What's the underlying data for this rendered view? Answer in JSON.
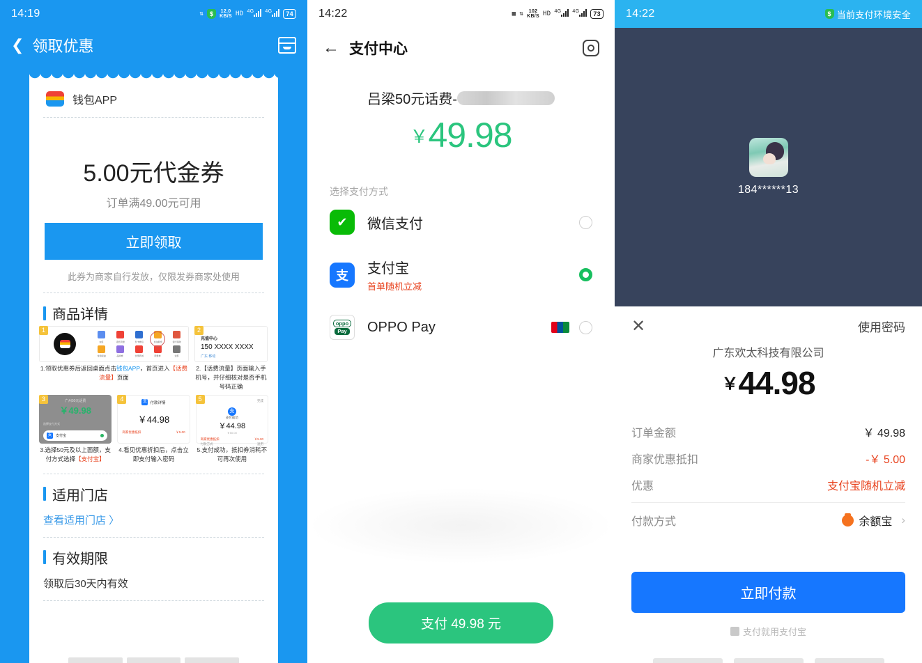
{
  "panel1": {
    "statusbar": {
      "time": "14:19",
      "net_speed": "12.0",
      "net_unit": "KB/S",
      "hd": "HD",
      "net_type": "4G",
      "battery": "74"
    },
    "header": {
      "title": "领取优惠",
      "back_icon": "back-chevron",
      "right_icon": "ticket-icon"
    },
    "app": {
      "name": "钱包APP"
    },
    "coupon": {
      "amount": "5.00元代金券",
      "condition": "订单满49.00元可用",
      "claim_button": "立即领取",
      "note": "此券为商家自行发放，仅限发券商家处使用"
    },
    "sections": {
      "product_detail_title": "商品详情",
      "stores_title": "适用门店",
      "stores_link": "查看适用门店 〉",
      "validity_title": "有效期限",
      "validity_text": "领取后30天内有效"
    },
    "steps": [
      {
        "num": "1",
        "caption_pre": "1.领取优惠券后返回桌面点击",
        "caption_hl": "钱包APP",
        "caption_mid": "，首页进入",
        "caption_hl2": "【话费流量】",
        "caption_post": "页面",
        "shot": {
          "grid_labels": [
            "充值",
            "话费流量",
            "影卡券包",
            "加油服务",
            "银行理财",
            "常用权益",
            "品牌券",
            "优惠商城",
            "限量券",
            "全部"
          ],
          "highlight": "话费流量"
        }
      },
      {
        "num": "2",
        "caption": "2.【话费流量】页面输入手机号，并仔细核对是否手机号码正确",
        "shot": {
          "title": "充值中心",
          "phone": "150 XXXX XXXX",
          "carrier": "广东 移动"
        }
      },
      {
        "num": "3",
        "caption_pre": "3.选择50元及以上面额，支付方式选择",
        "caption_hl": "【支付宝】",
        "shot": {
          "product": "广州50元话费",
          "price": "￥49.98",
          "method_label": "选择支付方式",
          "method": "支付宝"
        }
      },
      {
        "num": "4",
        "caption": "4.看见优惠折扣后，点击立即支付输入密码",
        "shot": {
          "title": "付款详情",
          "price": "￥44.98",
          "discount_label": "商家优惠抵扣",
          "discount": "￥5.00"
        }
      },
      {
        "num": "5",
        "caption": "5.支付成功，抵扣券消耗不可再次使用",
        "shot": {
          "status": "完成",
          "success": "支付成功",
          "price": "￥44.98",
          "orig": "￥50.00",
          "discount_label": "商家优惠抵扣",
          "discount": "￥5.00",
          "method_label": "付款方式",
          "method": "通用"
        }
      }
    ]
  },
  "panel2": {
    "statusbar": {
      "time": "14:22",
      "net_speed": "102",
      "net_unit": "KB/S",
      "hd": "HD",
      "net_type": "4G",
      "battery": "73"
    },
    "header": {
      "title": "支付中心",
      "back_icon": "arrow-left-icon",
      "settings_icon": "gear-icon"
    },
    "order": {
      "product_name": "吕梁50元话费-",
      "redacted": true,
      "currency": "￥",
      "amount": "49.98"
    },
    "pay_section_label": "选择支付方式",
    "methods": [
      {
        "name": "微信支付",
        "sub": "",
        "selected": false,
        "icon": "wechat-pay-icon"
      },
      {
        "name": "支付宝",
        "sub": "首单随机立减",
        "selected": true,
        "icon": "alipay-icon"
      },
      {
        "name": "OPPO Pay",
        "sub": "",
        "selected": false,
        "icon": "oppo-pay-icon",
        "badge": "unionpay-icon"
      }
    ],
    "pay_button": "支付 49.98 元"
  },
  "panel3": {
    "statusbar": {
      "time": "14:22",
      "secure_text": "当前支付环境安全",
      "shield_icon": "shield-icon"
    },
    "account": {
      "phone_masked": "184******13",
      "avatar": "user-avatar"
    },
    "sheet": {
      "close_icon": "close-icon",
      "use_password": "使用密码",
      "merchant": "广东欢太科技有限公司",
      "currency": "￥",
      "amount": "44.98",
      "rows": [
        {
          "label": "订单金额",
          "value": "￥ 49.98",
          "red": false
        },
        {
          "label": "商家优惠抵扣",
          "value": "-￥ 5.00",
          "red": true
        },
        {
          "label": "优惠",
          "value": "支付宝随机立减",
          "red": true
        }
      ],
      "payment_method_label": "付款方式",
      "payment_method": "余额宝",
      "pay_button": "立即付款",
      "footer": "支付就用支付宝"
    }
  },
  "colors": {
    "blue": "#1a97f0",
    "alipay_blue": "#1677ff",
    "green": "#2bc57e",
    "wechat_green": "#09bb07",
    "red": "#e8431f",
    "dark_bg": "#37435c",
    "cyan": "#2bb3f0"
  }
}
